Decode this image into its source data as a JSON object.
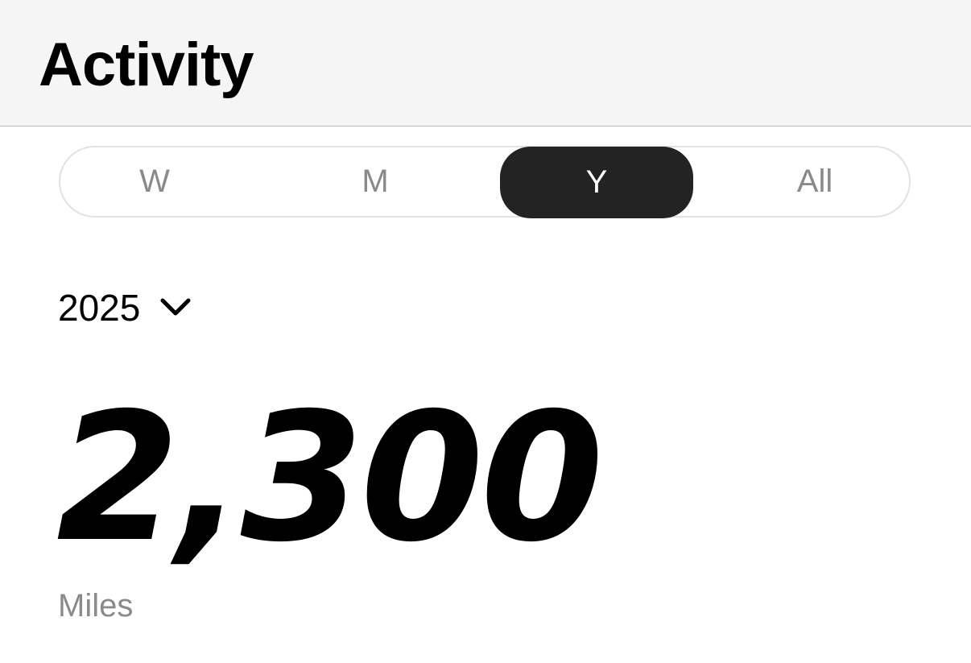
{
  "header": {
    "title": "Activity"
  },
  "period_selector": {
    "options": [
      {
        "label": "W"
      },
      {
        "label": "M"
      },
      {
        "label": "Y"
      },
      {
        "label": "All"
      }
    ],
    "selected": "Y"
  },
  "year_picker": {
    "value": "2025",
    "icon": "chevron-down-icon"
  },
  "summary": {
    "value": "2,300",
    "unit": "Miles"
  },
  "colors": {
    "header_bg": "#f5f5f5",
    "selected_bg": "#232323",
    "muted_text": "#8a8a8a"
  }
}
